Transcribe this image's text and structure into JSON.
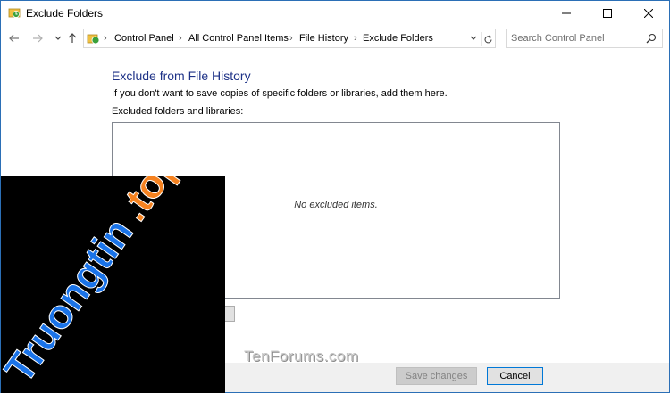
{
  "window": {
    "title": "Exclude Folders",
    "minimize": "minimize",
    "maximize": "maximize",
    "close": "close"
  },
  "nav": {
    "breadcrumbs": [
      "Control Panel",
      "All Control Panel Items",
      "File History",
      "Exclude Folders"
    ],
    "search_placeholder": "Search Control Panel"
  },
  "content": {
    "heading": "Exclude from File History",
    "description": "If you don't want to save copies of specific folders or libraries, add them here.",
    "list_label": "Excluded folders and libraries:",
    "empty_text": "No excluded items."
  },
  "footer": {
    "save_label": "Save changes",
    "cancel_label": "Cancel"
  },
  "watermarks": {
    "tenforums": "TenForums.com",
    "logo": "Truongtin.top"
  },
  "colors": {
    "heading": "#1e3287",
    "accent": "#0078d7",
    "logo_blue": "#1a73e8",
    "logo_orange": "#f58220"
  }
}
